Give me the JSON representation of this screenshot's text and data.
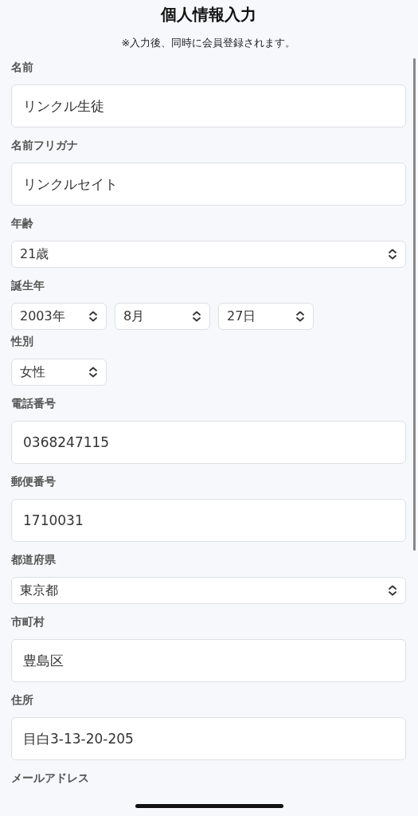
{
  "title": "個人情報入力",
  "note": "※入力後、同時に会員登録されます。",
  "fields": [
    {
      "label": "名前",
      "kind": "text",
      "value": "リンクル生徒"
    },
    {
      "label": "名前フリガナ",
      "kind": "text",
      "value": "リンクルセイト"
    },
    {
      "label": "年齢",
      "kind": "select",
      "value": "21歳"
    },
    {
      "label": "誕生年",
      "kind": "select_group",
      "selects": [
        "2003年",
        "8月",
        "27日"
      ]
    },
    {
      "label": "性別",
      "kind": "select_small",
      "value": "女性"
    },
    {
      "label": "電話番号",
      "kind": "text",
      "value": "0368247115"
    },
    {
      "label": "郵便番号",
      "kind": "text",
      "value": "1710031"
    },
    {
      "label": "都道府県",
      "kind": "select",
      "value": "東京都"
    },
    {
      "label": "市町村",
      "kind": "text",
      "value": "豊島区"
    },
    {
      "label": "住所",
      "kind": "text",
      "value": "目白3-13-20-205"
    },
    {
      "label": "メールアドレス",
      "kind": "label_only"
    }
  ]
}
